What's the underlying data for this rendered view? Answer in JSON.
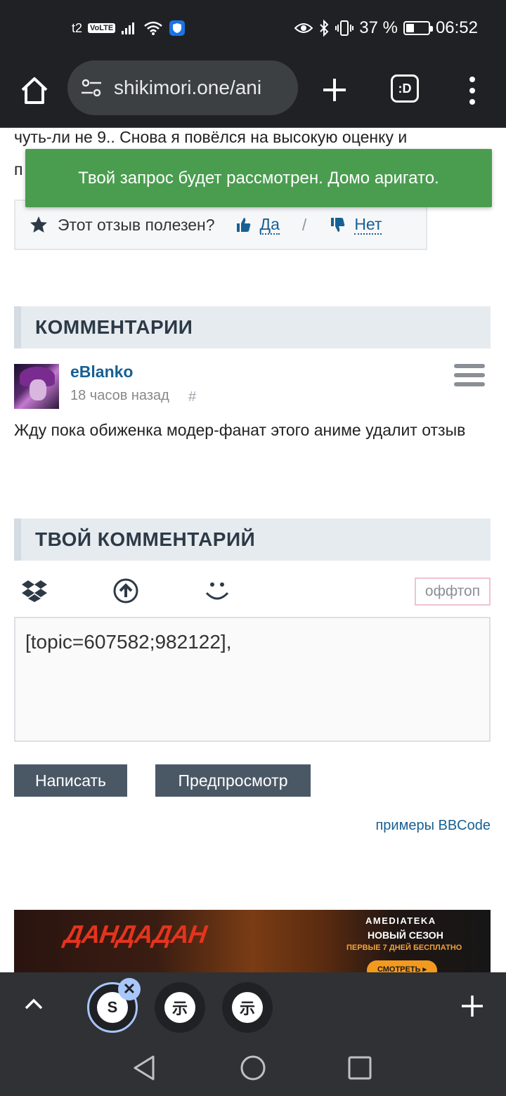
{
  "status_bar": {
    "carrier": "t2",
    "volte": "VoLTE",
    "battery_percent": "37 %",
    "battery_level": 0.37,
    "time": "06:52"
  },
  "toolbar": {
    "url": "shikimori.one/ani",
    "tabs_label": ":D"
  },
  "page": {
    "partial_line": "чуть-ли не 9.. Снова я повёлся на высокую оценку и",
    "partial_line2": "п",
    "useful": {
      "question": "Этот отзыв полезен?",
      "yes": "Да",
      "separator": "/",
      "no": "Нет"
    },
    "comments_heading": "КОММЕНТАРИИ",
    "comment": {
      "user": "eBlanko",
      "time": "18 часов назад",
      "hash": "#",
      "body": "Жду пока обиженка модер-фанат этого аниме удалит отзыв"
    },
    "your_comment_heading": "ТВОЙ КОММЕНТАРИЙ",
    "editor": {
      "offtop": "оффтоп",
      "text": "[topic=607582;982122],",
      "send": "Написать",
      "preview": "Предпросмотр",
      "bbcode_link": "примеры BBCode"
    },
    "ad": {
      "title": "ДАНДАДАН",
      "brand": "AMEDIATEKA",
      "season": "НОВЫЙ СЕЗОН",
      "free": "ПЕРВЫЕ 7 ДНЕЙ БЕСПЛАТНО",
      "button": "СМОТРЕТЬ ▸"
    }
  },
  "toast": {
    "message": "Твой запрос будет рассмотрен. Домо аригато."
  },
  "tab_strip": {
    "tab1": "S",
    "tab2": "示",
    "tab3": "示",
    "close": "✕"
  },
  "colors": {
    "toast_bg": "#4a9d4f",
    "link": "#176093",
    "button_bg": "#4a5866",
    "chrome_dark": "#202124"
  }
}
